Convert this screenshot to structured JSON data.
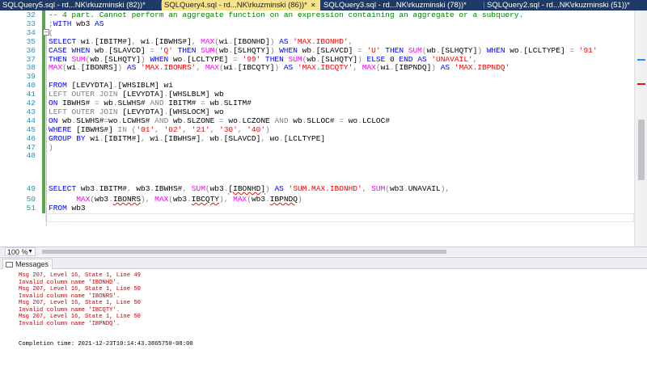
{
  "tabs": [
    {
      "label": "SQLQuery5.sql - rd...NK\\rkuzminski (82))*",
      "active": false
    },
    {
      "label": "SQLQuery4.sql - rd...NK\\rkuzminski (86))*",
      "active": true
    },
    {
      "label": "SQLQuery3.sql - rd...NK\\rkuzminski (78))*",
      "active": false
    },
    {
      "label": "SQLQuery2.sql - rd...NK\\rkuzminski (51))*",
      "active": false
    }
  ],
  "tab_close_glyph": "✕",
  "editor": {
    "line_numbers": [
      "32",
      "33",
      "34",
      "35",
      "36",
      "37",
      "38",
      "39",
      "40",
      "41",
      "42",
      "43",
      "44",
      "45",
      "46",
      "47",
      "48",
      "49",
      "50",
      "51"
    ],
    "top_line_comment": "-- 4 part. Cannot perform an aggregate function on an expression containing an aggregate or a subquery.",
    "fold_glyph": "−"
  },
  "zoom": {
    "value": "100 %"
  },
  "results": {
    "tab_label": "Messages",
    "messages": [
      {
        "text": "Msg 207, Level 16, State 1, Line 49",
        "color": "#c00000"
      },
      {
        "text": "Invalid column name 'IBONHD'.",
        "color": "#c00000"
      },
      {
        "text": "Msg 207, Level 16, State 1, Line 50",
        "color": "#c00000"
      },
      {
        "text": "Invalid column name 'IBONRS'.",
        "color": "#c00000"
      },
      {
        "text": "Msg 207, Level 16, State 1, Line 50",
        "color": "#c00000"
      },
      {
        "text": "Invalid column name 'IBCQTY'.",
        "color": "#c00000"
      },
      {
        "text": "Msg 207, Level 16, State 1, Line 50",
        "color": "#c00000"
      },
      {
        "text": "Invalid column name 'IBPNDQ'.",
        "color": "#c00000"
      }
    ],
    "completion": "Completion time: 2021-12-23T10:14:43.3865750-08:00"
  },
  "colors": {
    "keyword": "#0000ff",
    "function": "#ff00ff",
    "string": "#ff0000",
    "operator": "#808080",
    "comment": "#008000",
    "line_number": "#2b91af",
    "error_text": "#c00000",
    "active_tab": "#f7e38a",
    "tab_strip": "#1e3a66"
  }
}
